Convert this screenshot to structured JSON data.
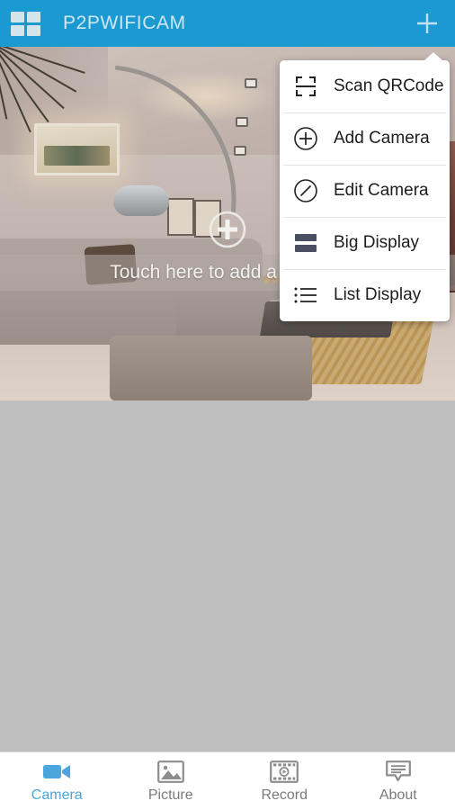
{
  "header": {
    "title": "P2PWIFICAM",
    "grid_icon": "grid-menu-icon",
    "add_icon": "plus-icon",
    "background_color": "#1b9ad1",
    "title_color": "#cfe6f2"
  },
  "camera_view": {
    "overlay_text": "Touch here to add a camera",
    "add_overlay_icon": "circle-plus-icon",
    "empty_background_color": "#bfbfbf"
  },
  "menu": {
    "items": [
      {
        "label": "Scan QRCode",
        "icon": "qr-scan-icon"
      },
      {
        "label": "Add Camera",
        "icon": "circle-plus-icon"
      },
      {
        "label": "Edit Camera",
        "icon": "circle-slash-edit-icon"
      },
      {
        "label": "Big Display",
        "icon": "big-display-icon"
      },
      {
        "label": "List Display",
        "icon": "list-display-icon"
      }
    ],
    "background_color": "#ffffff",
    "divider_color": "#e6e4e3",
    "big_display_icon_color": "#4a4f63"
  },
  "tabbar": {
    "active_color": "#4aa6dd",
    "inactive_color": "#7b7b7b",
    "tabs": [
      {
        "label": "Camera",
        "icon": "video-camera-icon",
        "active": true
      },
      {
        "label": "Picture",
        "icon": "photo-image-icon",
        "active": false
      },
      {
        "label": "Record",
        "icon": "film-play-icon",
        "active": false
      },
      {
        "label": "About",
        "icon": "speech-bubble-icon",
        "active": false
      }
    ]
  }
}
